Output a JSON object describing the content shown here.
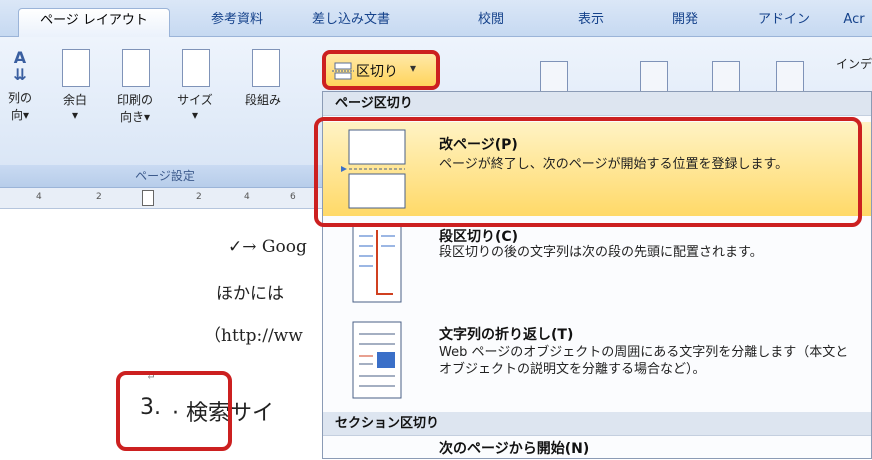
{
  "tabs": [
    "ページ レイアウト",
    "参考資料",
    "差し込み文書",
    "校閲",
    "表示",
    "開発",
    "アドイン",
    "Acr"
  ],
  "ribbon": {
    "buttons": [
      {
        "label1": "列の",
        "label2": "向▾"
      },
      {
        "label1": "余白",
        "label2": "▾"
      },
      {
        "label1": "印刷の",
        "label2": "向き▾"
      },
      {
        "label1": "サイズ",
        "label2": "▾"
      },
      {
        "label1": "段組み",
        "label2": ""
      }
    ],
    "group_label": "ページ設定",
    "kugiri_label": "区切り",
    "kugiri_arrow": "▾",
    "right_label": "インデ"
  },
  "ruler": [
    "4",
    "2",
    "2",
    "4",
    "6"
  ],
  "document": {
    "line1": "✓→ Goog",
    "line2": "ほかには",
    "line3": "（http://ww",
    "line4_prefix": "3.",
    "line4_text": "· 検索サイ",
    "return_mark": "↵"
  },
  "menu": {
    "header_page": "ページ区切り",
    "items": [
      {
        "title": "改ページ(P)",
        "desc": "ページが終了し、次のページが開始する位置を登録します。"
      },
      {
        "title": "段区切り(C)",
        "desc": "段区切りの後の文字列は次の段の先頭に配置されます。"
      },
      {
        "title": "文字列の折り返し(T)",
        "desc": "Web ページのオブジェクトの周囲にある文字列を分離します（本文とオブジェクトの説明文を分離する場合など）。"
      }
    ],
    "header_section": "セクション区切り",
    "next_item": "次のページから開始(N)"
  },
  "colors": {
    "highlight": "#cc2020",
    "menu_hover": "#ffd45c",
    "ribbon": "#d7e4f5"
  }
}
